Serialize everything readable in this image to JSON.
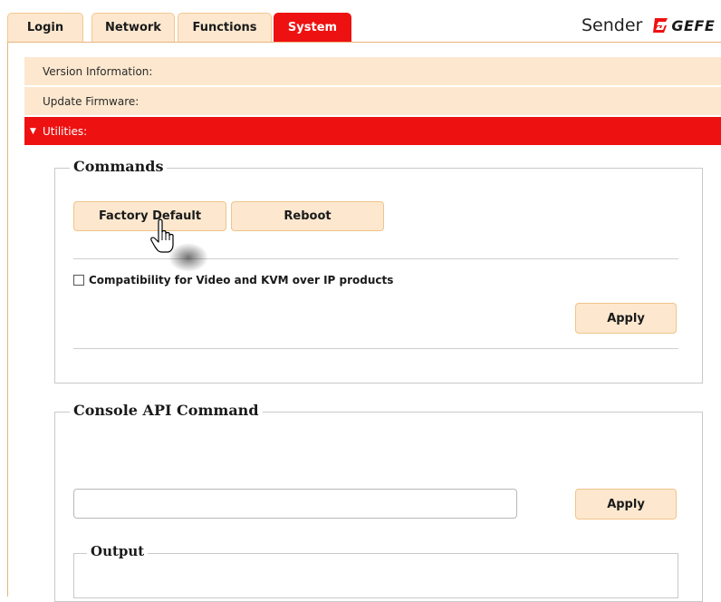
{
  "tabs": [
    {
      "label": "Login",
      "active": false
    },
    {
      "label": "Network",
      "active": false
    },
    {
      "label": "Functions",
      "active": false
    },
    {
      "label": "System",
      "active": true
    }
  ],
  "brand": {
    "device_label": "Sender",
    "logo_text": "GEFE"
  },
  "sections": [
    {
      "label": "Version Information:",
      "expanded": false
    },
    {
      "label": "Update Firmware:",
      "expanded": false
    },
    {
      "label": "Utilities:",
      "expanded": true
    }
  ],
  "commands": {
    "legend": "Commands",
    "factory_default_label": "Factory Default",
    "reboot_label": "Reboot",
    "compat_label": "Compatibility for Video and KVM over IP products",
    "compat_checked": false,
    "apply_label": "Apply"
  },
  "console": {
    "legend": "Console API Command",
    "input_value": "",
    "input_placeholder": "",
    "apply_label": "Apply",
    "output_legend": "Output"
  },
  "colors": {
    "accent_red": "#ee1111",
    "panel_peach": "#fde8cf",
    "border_orange": "#f0c48a"
  },
  "icons": {
    "cursor": "hand-pointer-icon",
    "section_collapsed": "triangle-right-icon",
    "section_expanded": "triangle-down-icon",
    "logo_mark": "gefen-logo-icon"
  }
}
